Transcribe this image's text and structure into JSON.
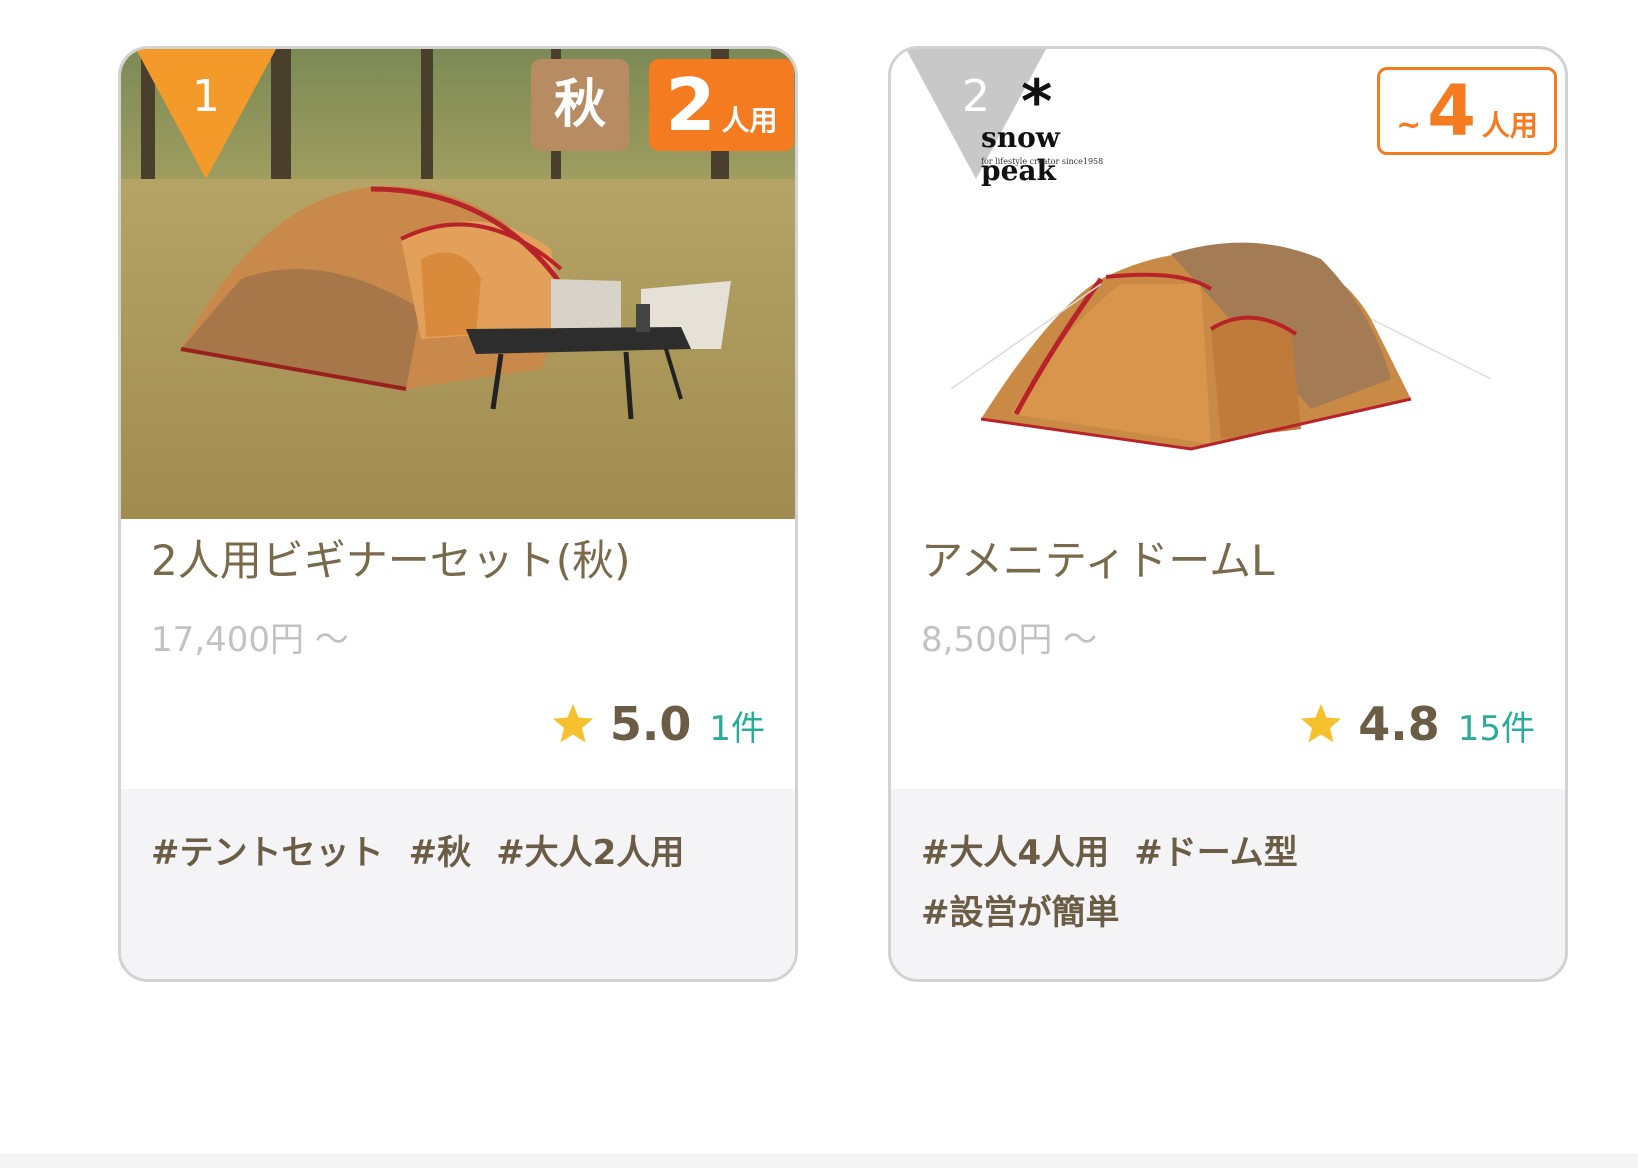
{
  "products": [
    {
      "rank": "1",
      "season_badge": "秋",
      "capacity_num": "2",
      "capacity_unit": "人用",
      "title": "2人用ビギナーセット(秋)",
      "price": "17,400円 〜",
      "rating": "5.0",
      "review_count": "1件",
      "tags": [
        "#テントセット",
        "#秋",
        "#大人2人用"
      ],
      "image": "tent-set-photo",
      "rank_color": "#f39a2b"
    },
    {
      "rank": "2",
      "capacity_prefix": "~",
      "capacity_num": "4",
      "capacity_unit": "人用",
      "brand_logo": "snow peak",
      "brand_tagline": "for lifestyle creator   since1958",
      "title": "アメニティドームL",
      "price": "8,500円 〜",
      "rating": "4.8",
      "review_count": "15件",
      "tags": [
        "#大人4人用",
        "#ドーム型",
        "#設営が簡単"
      ],
      "image": "dome-tent-photo",
      "rank_color": "#c8c8c8"
    }
  ],
  "colors": {
    "accent_orange": "#f47b20",
    "season_tan": "#b78c63",
    "title_brown": "#7a6a4c",
    "review_teal": "#2bab9a",
    "star_yellow": "#f5c12e"
  },
  "icons": [
    "star-icon",
    "snowflake-logo-icon"
  ]
}
